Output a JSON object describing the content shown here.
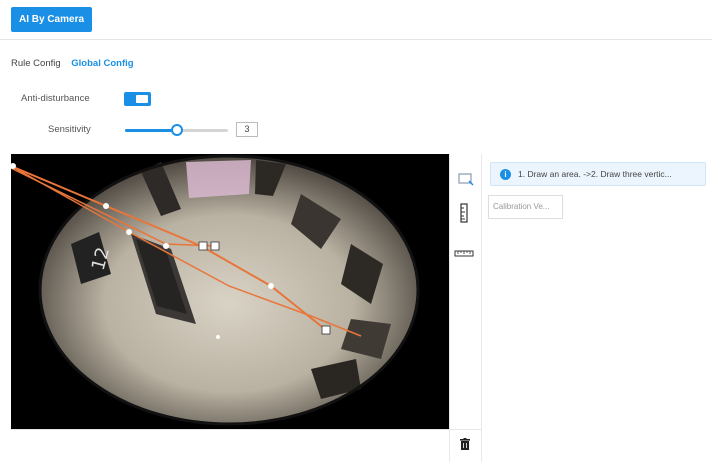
{
  "header": {
    "ai_by_camera_label": "AI By Camera"
  },
  "tabs": {
    "rule_config": "Rule Config",
    "global_config": "Global Config"
  },
  "settings": {
    "anti_disturbance_label": "Anti-disturbance",
    "anti_disturbance_enabled": true,
    "sensitivity_label": "Sensitivity",
    "sensitivity_value": "3",
    "sensitivity_min": 1,
    "sensitivity_max": 5
  },
  "right_panel": {
    "hint_text": "1. Draw an area. ->2. Draw three vertic...",
    "calibration_button": "Calibration Ve..."
  },
  "icons": {
    "draw_area": "draw-area-icon",
    "vertical_ruler": "vertical-ruler-icon",
    "horizontal_ruler": "horizontal-ruler-icon",
    "delete": "trash-icon",
    "info": "info-icon"
  },
  "colors": {
    "accent": "#1a8fe6",
    "overlay_line": "#e8753a"
  }
}
